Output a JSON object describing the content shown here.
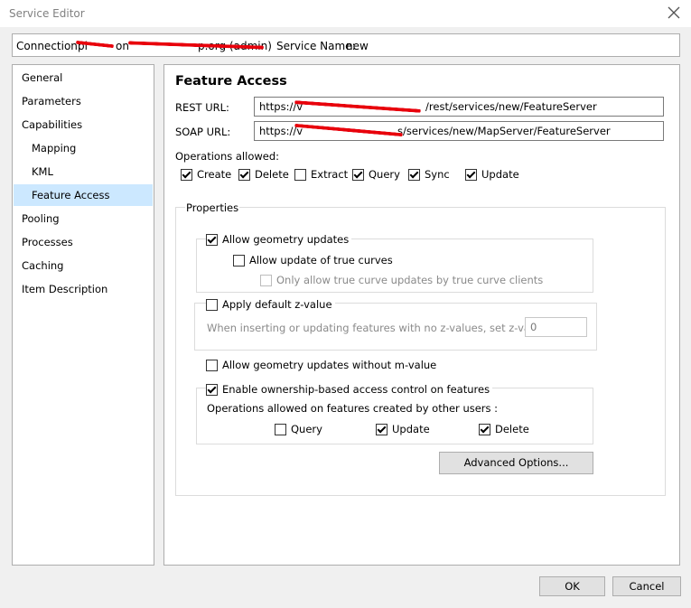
{
  "window": {
    "title": "Service Editor"
  },
  "connection": {
    "label": "Connection:",
    "value_visible_start": "pl",
    "value_visible_middle": "on",
    "value_visible_end": "p.org (admin)",
    "service_name_label": "Service Name:",
    "service_name_value": "new"
  },
  "nav": {
    "items": [
      {
        "label": "General"
      },
      {
        "label": "Parameters"
      },
      {
        "label": "Capabilities"
      },
      {
        "label": "Mapping"
      },
      {
        "label": "KML"
      },
      {
        "label": "Feature Access"
      },
      {
        "label": "Pooling"
      },
      {
        "label": "Processes"
      },
      {
        "label": "Caching"
      },
      {
        "label": "Item Description"
      }
    ],
    "selected": "Feature Access"
  },
  "feature_access": {
    "title": "Feature Access",
    "rest_url_label": "REST URL:",
    "rest_url_prefix": "https://",
    "rest_url_mid": "v",
    "rest_url_suffix": "/rest/services/new/FeatureServer",
    "soap_url_label": "SOAP URL:",
    "soap_url_prefix": "https://",
    "soap_url_mid": "v",
    "soap_url_suffix": "s/services/new/MapServer/FeatureServer",
    "operations_label": "Operations allowed:",
    "operations": [
      {
        "label": "Create",
        "checked": true
      },
      {
        "label": "Delete",
        "checked": true
      },
      {
        "label": "Extract",
        "checked": false
      },
      {
        "label": "Query",
        "checked": true
      },
      {
        "label": "Sync",
        "checked": true
      },
      {
        "label": "Update",
        "checked": true
      }
    ]
  },
  "properties": {
    "title": "Properties",
    "allow_geometry_updates": {
      "label": "Allow geometry updates",
      "checked": true
    },
    "allow_true_curves": {
      "label": "Allow update of true curves",
      "checked": false
    },
    "only_true_curve_clients": {
      "label": "Only allow true curve updates by true curve clients",
      "checked": false
    },
    "apply_default_z": {
      "label": "Apply default z-value",
      "checked": false
    },
    "z_value_text": "When inserting or updating features with no z-values, set z-value to:",
    "z_value": "0",
    "allow_without_m": {
      "label": "Allow geometry updates without m-value",
      "checked": false
    },
    "ownership": {
      "label": "Enable ownership-based access control on features",
      "checked": true
    },
    "others_ops_label": "Operations allowed on features created by other users :",
    "others_ops": [
      {
        "label": "Query",
        "checked": false
      },
      {
        "label": "Update",
        "checked": true
      },
      {
        "label": "Delete",
        "checked": true
      }
    ],
    "advanced_button": "Advanced Options..."
  },
  "footer": {
    "ok": "OK",
    "cancel": "Cancel"
  },
  "colors": {
    "redaction": "#e8000b",
    "selection": "#cce8ff"
  }
}
